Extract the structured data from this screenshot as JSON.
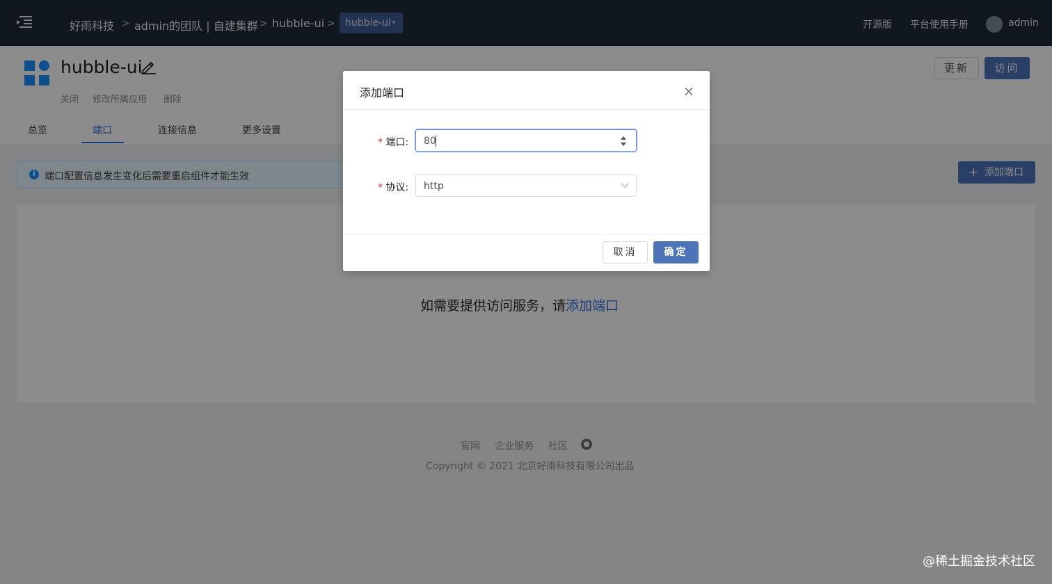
{
  "topbar": {
    "breadcrumb": [
      "好雨科技",
      "admin的团队 | 自建集群",
      "hubble-ui"
    ],
    "separator": ">",
    "current_app": "hubble-ui",
    "current_app_caret": "▾",
    "links": [
      "开源版",
      "平台使用手册"
    ],
    "username": "admin"
  },
  "app": {
    "title": "hubble-ui",
    "actions": [
      "关闭",
      "修改所属应用",
      "删除"
    ],
    "update_label": "更新",
    "visit_label": "访问",
    "tabs": [
      "总览",
      "端口",
      "连接信息",
      "更多设置"
    ],
    "active_tab": "端口"
  },
  "content": {
    "alert_icon_glyph": "i",
    "alert_text": "端口配置信息发生变化后需要重启组件才能生效",
    "add_port_plus": "+",
    "add_port_label": "添加端口",
    "empty_text": "如需要提供访问服务，请",
    "empty_link": "添加端口"
  },
  "footer": {
    "links": [
      "官网",
      "企业服务",
      "社区"
    ],
    "copyright": "Copyright © 2021 北京好雨科技有限公司出品"
  },
  "watermark": "@稀土掘金技术社区",
  "modal": {
    "title": "添加端口",
    "close_glyph": "×",
    "required_mark": "*",
    "port_label": "端口:",
    "port_value": "80",
    "protocol_label": "协议:",
    "protocol_value": "http",
    "cancel_label": "取消",
    "ok_label": "确定"
  },
  "colors": {
    "topbar_bg": "#202b38",
    "primary": "#4d73b9",
    "link": "#2e6bd8",
    "logo": "#1890ff"
  }
}
